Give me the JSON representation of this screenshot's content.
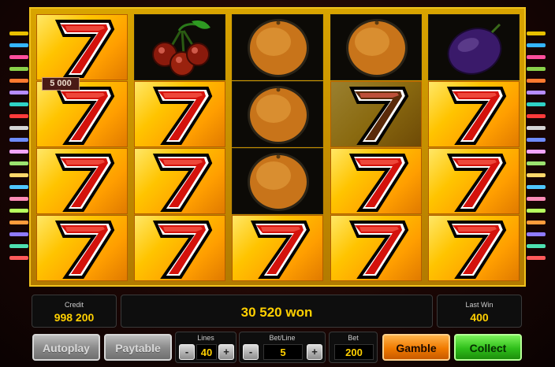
{
  "reels": [
    [
      "seven",
      "cherries",
      "orange",
      "orange",
      "plum"
    ],
    [
      "seven",
      "seven",
      "orange",
      "seven",
      "seven"
    ],
    [
      "seven",
      "seven",
      "orange",
      "seven",
      "seven"
    ],
    [
      "seven",
      "seven",
      "seven",
      "seven",
      "seven"
    ]
  ],
  "win_badge": "5 000",
  "credit": {
    "label": "Credit",
    "value": "998 200"
  },
  "won_text": "30 520 won",
  "last_win": {
    "label": "Last Win",
    "value": "400"
  },
  "buttons": {
    "autoplay": "Autoplay",
    "paytable": "Paytable",
    "gamble": "Gamble",
    "collect": "Collect"
  },
  "lines": {
    "label": "Lines",
    "value": "40"
  },
  "bet_line": {
    "label": "Bet/Line",
    "value": "5"
  },
  "bet": {
    "label": "Bet",
    "value": "200"
  },
  "stepper": {
    "minus": "-",
    "plus": "+"
  },
  "colors": {
    "frame": "#d9a400",
    "accent": "#ffd000",
    "gamble": "#f07a00",
    "collect": "#2fbf1a"
  },
  "icons": {
    "seven": "seven-icon",
    "cherries": "cherries-icon",
    "orange": "orange-icon",
    "plum": "plum-icon"
  }
}
